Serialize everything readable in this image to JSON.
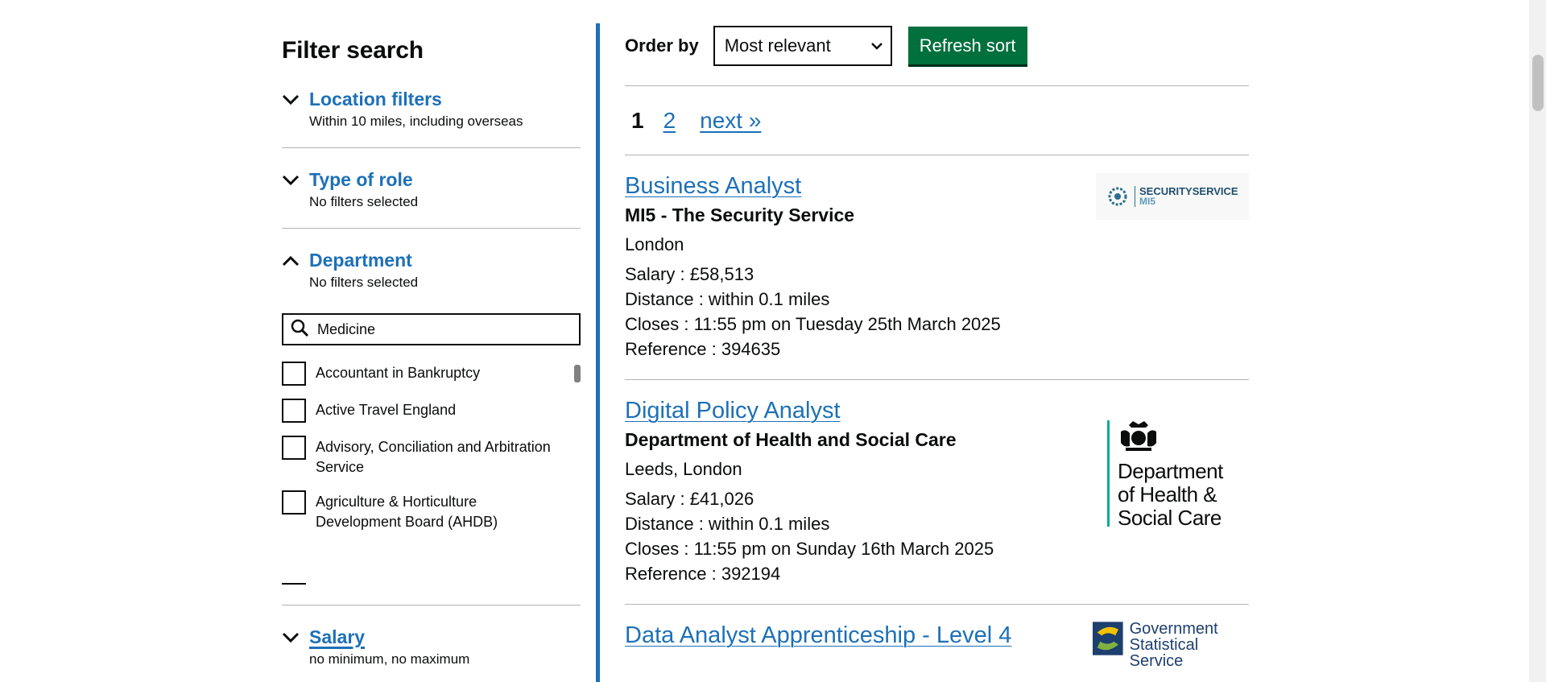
{
  "sidebar": {
    "title": "Filter search",
    "location": {
      "label": "Location filters",
      "sub": "Within 10 miles, including overseas"
    },
    "type_of_role": {
      "label": "Type of role",
      "sub": "No filters selected"
    },
    "department": {
      "label": "Department",
      "sub": "No filters selected",
      "search_value": "Medicine",
      "items": [
        {
          "label": "Accountant in Bankruptcy"
        },
        {
          "label": "Active Travel England"
        },
        {
          "label": "Advisory, Conciliation and Arbitration Service"
        },
        {
          "label": "Agriculture & Horticulture Development Board (AHDB)"
        }
      ]
    },
    "salary": {
      "label": "Salary",
      "sub": "no minimum, no maximum"
    }
  },
  "sort": {
    "label": "Order by",
    "selected": "Most relevant",
    "button": "Refresh sort"
  },
  "pagination": {
    "current": "1",
    "page2": "2",
    "next": "next »"
  },
  "jobs": [
    {
      "title": "Business Analyst",
      "department": "MI5 - The Security Service",
      "location": "London",
      "salary": "Salary : £58,513",
      "distance": "Distance : within 0.1 miles",
      "closes": "Closes : 11:55 pm on Tuesday 25th March 2025",
      "reference": "Reference : 394635",
      "logo_line1": "SECURITYSERVICE",
      "logo_line2": "MI5"
    },
    {
      "title": "Digital Policy Analyst",
      "department": "Department of Health and Social Care",
      "location": "Leeds, London",
      "salary": "Salary : £41,026",
      "distance": "Distance : within 0.1 miles",
      "closes": "Closes : 11:55 pm on Sunday 16th March 2025",
      "reference": "Reference : 392194",
      "logo_line1": "Department",
      "logo_line2": "of Health &",
      "logo_line3": "Social Care"
    },
    {
      "title": "Data Analyst Apprenticeship - Level 4",
      "logo_line1": "Government",
      "logo_line2": "Statistical Service"
    }
  ],
  "colors": {
    "link": "#1d70b8",
    "button": "#00703c",
    "text": "#0b0c0c",
    "divider": "#b1b4b6"
  }
}
